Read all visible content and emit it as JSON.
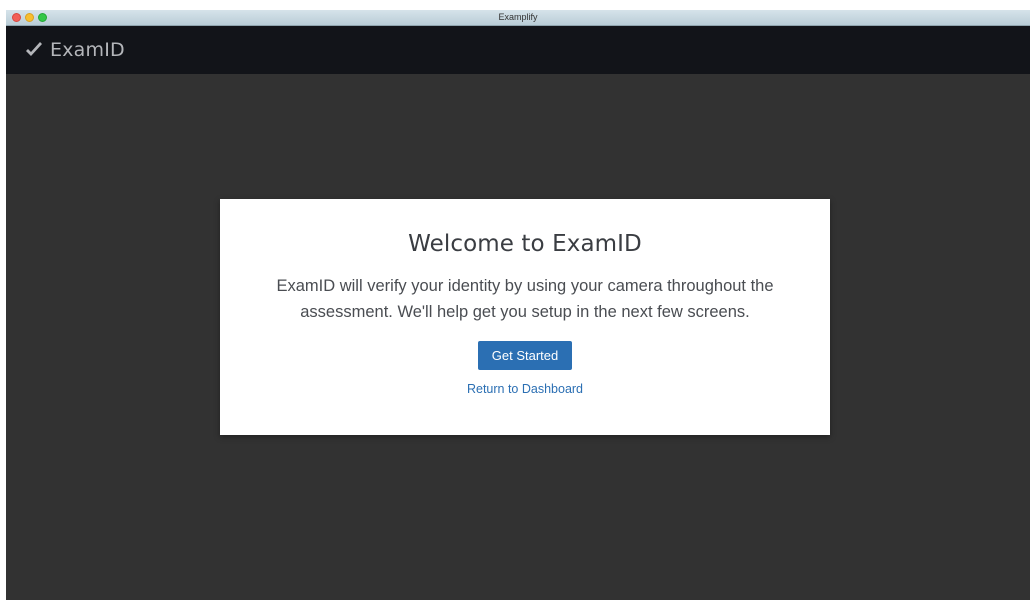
{
  "window": {
    "title": "Examplify"
  },
  "header": {
    "brand_name": "ExamID",
    "brand_icon": "checkmark-icon"
  },
  "modal": {
    "title": "Welcome to ExamID",
    "body": "ExamID will verify your identity by using your camera throughout the assessment. We'll help get you setup in the next few screens.",
    "primary_button_label": "Get Started",
    "secondary_link_label": "Return to Dashboard"
  },
  "colors": {
    "accent": "#2b6fb3",
    "header_bg": "#121419",
    "page_bg": "#323232"
  }
}
